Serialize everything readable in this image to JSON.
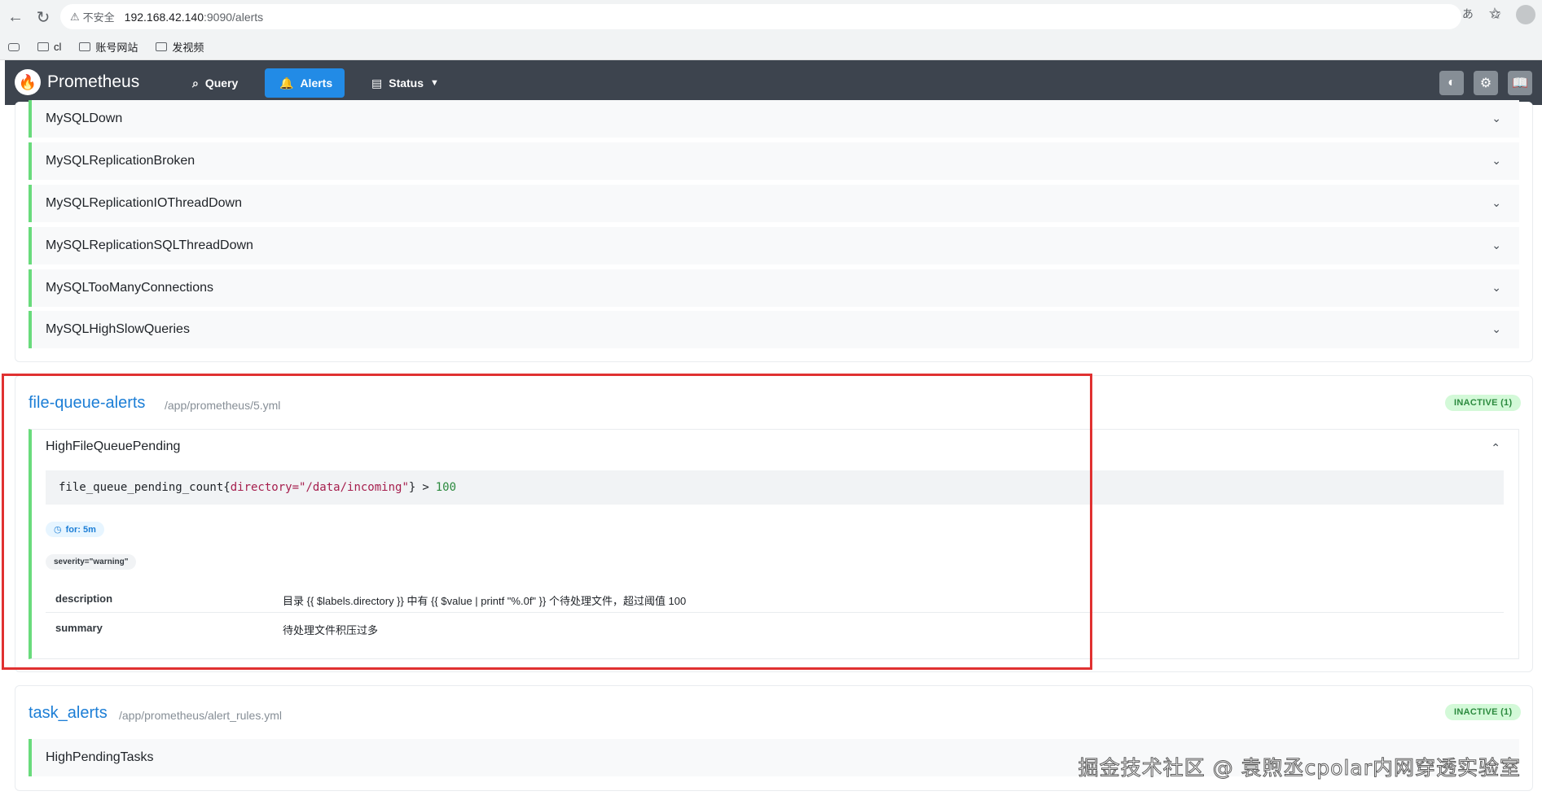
{
  "browser": {
    "insecure_label": "不安全",
    "url_host": "192.168.42.140",
    "url_path": ":9090/alerts",
    "bookmarks": [
      "cl",
      "账号网站",
      "发视频"
    ]
  },
  "header": {
    "brand": "Prometheus",
    "nav": {
      "query": "Query",
      "alerts": "Alerts",
      "status": "Status"
    }
  },
  "mysql_rules": [
    "MySQLDown",
    "MySQLReplicationBroken",
    "MySQLReplicationIOThreadDown",
    "MySQLReplicationSQLThreadDown",
    "MySQLTooManyConnections",
    "MySQLHighSlowQueries"
  ],
  "file_group": {
    "name": "file-queue-alerts",
    "file": "/app/prometheus/5.yml",
    "badge": "INACTIVE (1)",
    "rule": {
      "name": "HighFileQueuePending",
      "expr_metric": "file_queue_pending_count{",
      "expr_label_key": "directory=",
      "expr_label_val": "\"/data/incoming\"",
      "expr_close": "}",
      "expr_op": ">",
      "expr_threshold": "100",
      "for": "for: 5m",
      "label": "severity=\"warning\"",
      "annotations": [
        {
          "key": "description",
          "value": "目录 {{ $labels.directory }} 中有 {{ $value | printf \"%.0f\" }} 个待处理文件，超过阈值 100"
        },
        {
          "key": "summary",
          "value": "待处理文件积压过多"
        }
      ]
    }
  },
  "task_group": {
    "name": "task_alerts",
    "file": "/app/prometheus/alert_rules.yml",
    "badge": "INACTIVE (1)",
    "rule_name": "HighPendingTasks"
  },
  "watermark": "掘金技术社区 @ 袁煦丞cpolar内网穿透实验室"
}
